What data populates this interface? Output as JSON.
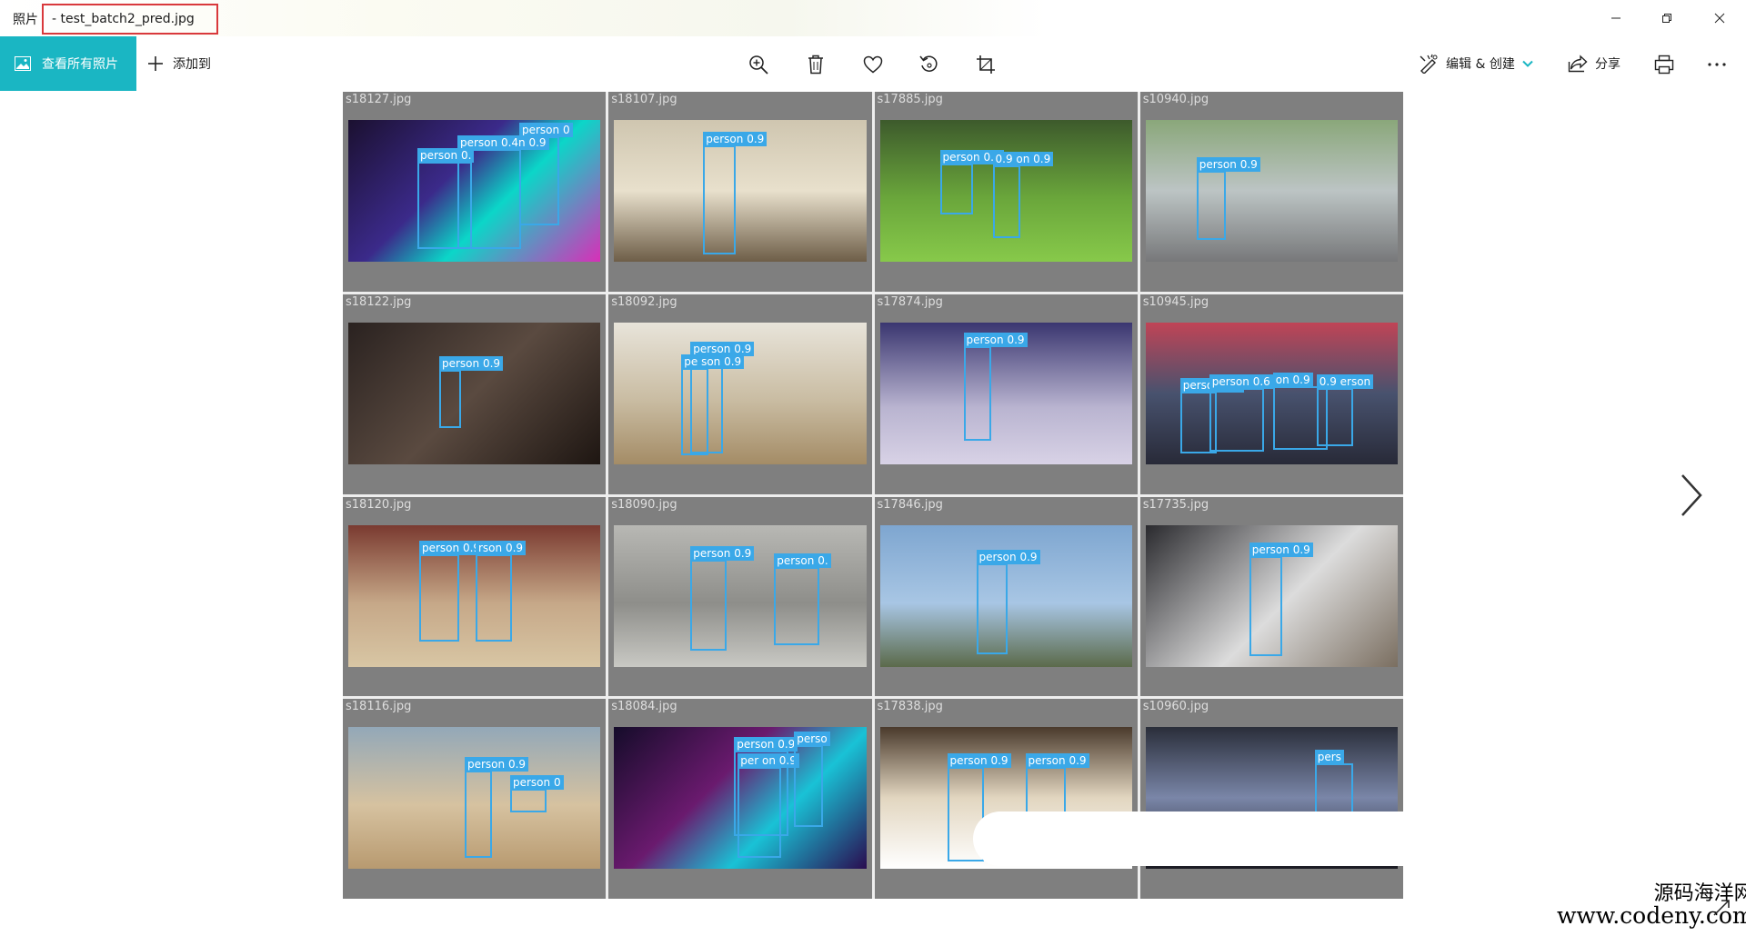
{
  "window": {
    "app_name": "照片",
    "file_title": "- test_batch2_pred.jpg",
    "minimize_icon": "minimize-icon",
    "maximize_icon": "restore-icon",
    "close_icon": "close-icon"
  },
  "toolbar": {
    "view_all_label": "查看所有照片",
    "add_to_label": "添加到",
    "edit_create_label": "编辑 & 创建",
    "share_label": "分享",
    "icons": [
      "zoom-in-icon",
      "delete-icon",
      "heart-icon",
      "rotate-icon",
      "crop-icon",
      "print-icon",
      "more-icon"
    ]
  },
  "colors": {
    "accent": "#1ab6c3",
    "detection_box": "#3aa8e8",
    "title_highlight": "#d9393c"
  },
  "grid": {
    "cells": [
      {
        "name": "s18127.jpg",
        "boxes": [
          {
            "label": "person 0"
          },
          {
            "label": "person 0.4n 0.9"
          },
          {
            "label": "person 0."
          }
        ]
      },
      {
        "name": "s18107.jpg",
        "boxes": [
          {
            "label": "person 0.9"
          }
        ]
      },
      {
        "name": "s17885.jpg",
        "boxes": [
          {
            "label": "person 0.9"
          },
          {
            "label": "0.9 on 0.9"
          }
        ]
      },
      {
        "name": "s10940.jpg",
        "boxes": [
          {
            "label": "person 0.9"
          }
        ]
      },
      {
        "name": "s18122.jpg",
        "boxes": [
          {
            "label": "person 0.9"
          }
        ]
      },
      {
        "name": "s18092.jpg",
        "boxes": [
          {
            "label": "person 0.9"
          },
          {
            "label": "pe son 0.9"
          }
        ]
      },
      {
        "name": "s17874.jpg",
        "boxes": [
          {
            "label": "person 0.9"
          }
        ]
      },
      {
        "name": "s10945.jpg",
        "boxes": [
          {
            "label": "person 0.5"
          },
          {
            "label": "person 0.6"
          },
          {
            "label": "on 0.9"
          },
          {
            "label": "0.9 erson"
          }
        ]
      },
      {
        "name": "s18120.jpg",
        "boxes": [
          {
            "label": "person 0.9"
          },
          {
            "label": "rson 0.9"
          }
        ]
      },
      {
        "name": "s18090.jpg",
        "boxes": [
          {
            "label": "person 0.9"
          },
          {
            "label": "person 0."
          }
        ]
      },
      {
        "name": "s17846.jpg",
        "boxes": [
          {
            "label": "person 0.9"
          }
        ]
      },
      {
        "name": "s17735.jpg",
        "boxes": [
          {
            "label": "person 0.9"
          }
        ]
      },
      {
        "name": "s18116.jpg",
        "boxes": [
          {
            "label": "person 0.9"
          },
          {
            "label": "person 0"
          }
        ]
      },
      {
        "name": "s18084.jpg",
        "boxes": [
          {
            "label": "person 0.9"
          },
          {
            "label": "per on 0.9"
          },
          {
            "label": "perso"
          }
        ]
      },
      {
        "name": "s17838.jpg",
        "boxes": [
          {
            "label": "person 0.9"
          },
          {
            "label": "person 0.9"
          }
        ]
      },
      {
        "name": "s10960.jpg",
        "boxes": [
          {
            "label": "pers"
          }
        ]
      }
    ]
  },
  "navigation": {
    "next_icon": "chevron-right-icon"
  },
  "watermark": {
    "line1": "源码海洋网",
    "line2": "www.codeny.com"
  }
}
